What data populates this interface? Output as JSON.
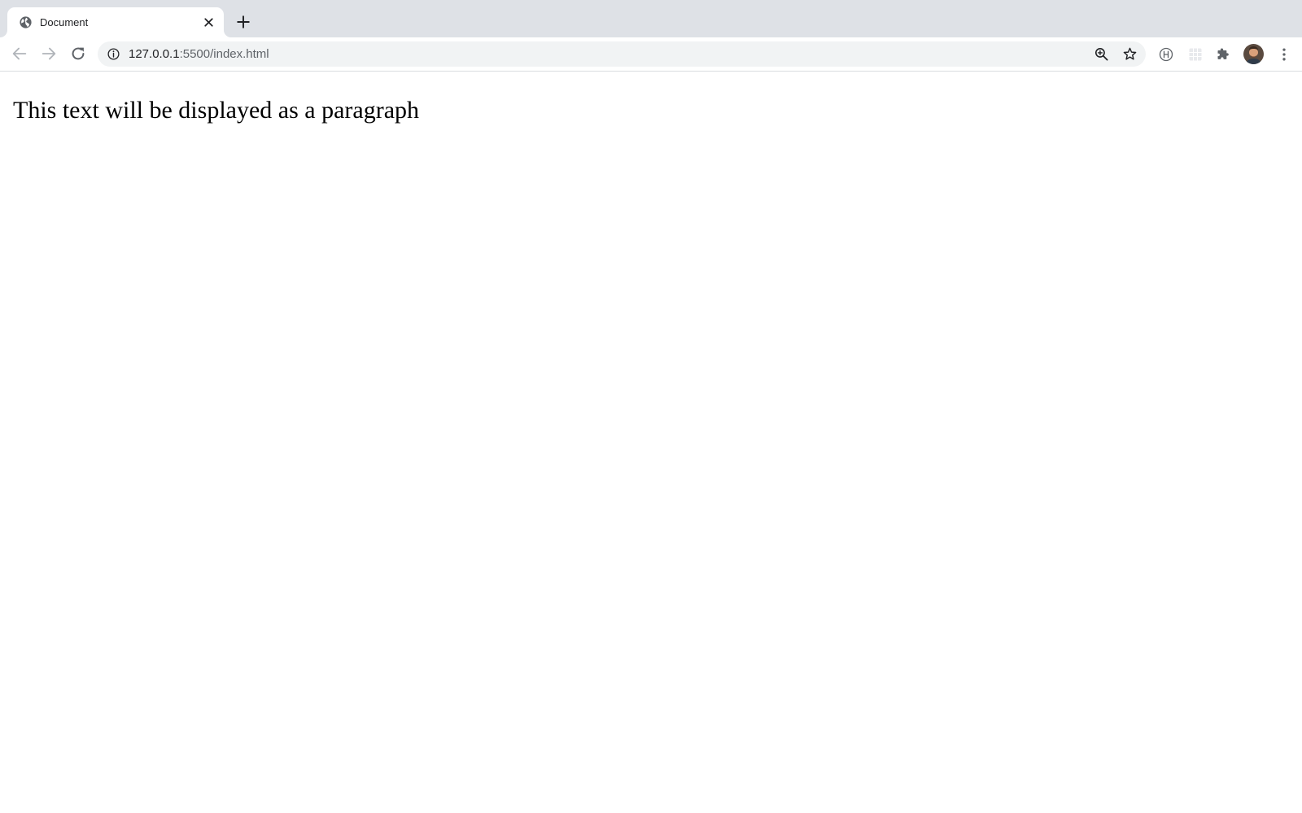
{
  "tab": {
    "title": "Document",
    "favicon": "globe-icon",
    "close_icon": "close-icon"
  },
  "new_tab_icon": "plus-icon",
  "toolbar": {
    "back_icon": "arrow-left-icon",
    "forward_icon": "arrow-right-icon",
    "reload_icon": "reload-icon",
    "address": {
      "info_icon": "info-icon",
      "host": "127.0.0.1",
      "rest": ":5500/index.html",
      "zoom_icon": "zoom-in-icon",
      "bookmark_icon": "star-icon"
    },
    "extensions": [
      "h-extension-icon",
      "grid-extension-icon",
      "puzzle-icon"
    ],
    "avatar": "avatar",
    "menu_icon": "kebab-menu-icon"
  },
  "page": {
    "paragraph": "This text will be displayed as a paragraph"
  },
  "colors": {
    "tabstrip_bg": "#dee1e6",
    "omnibox_bg": "#f1f3f4",
    "icon": "#5f6368",
    "text": "#202124"
  }
}
